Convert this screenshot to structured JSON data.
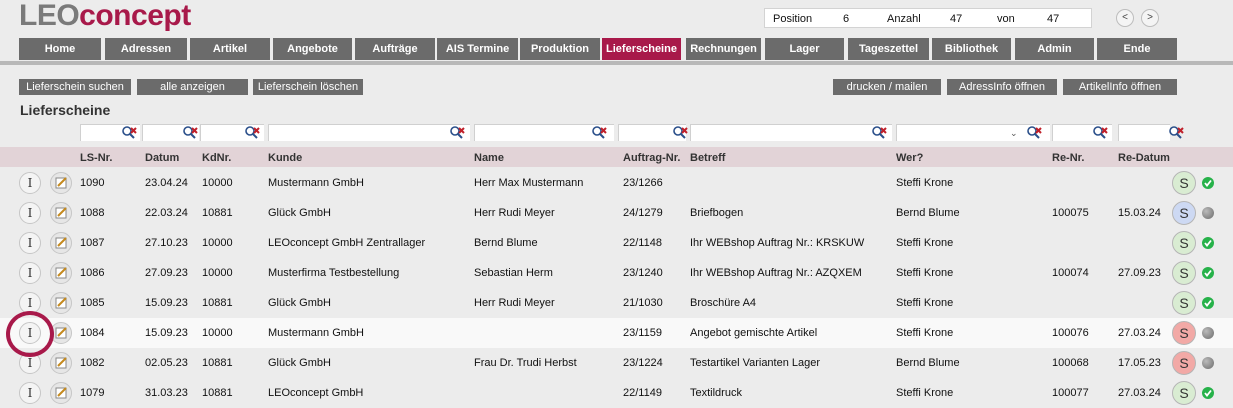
{
  "logo": {
    "part1": "LEO",
    "part2": "concept"
  },
  "position_box": {
    "position_label": "Position",
    "position_value": "6",
    "count_label": "Anzahl",
    "count_value": "47",
    "of_label": "von",
    "of_value": "47"
  },
  "nav_buttons": {
    "prev": "<",
    "next": ">"
  },
  "tabs": [
    "Home",
    "Adressen",
    "Artikel",
    "Angebote",
    "Aufträge",
    "AIS Termine",
    "Produktion",
    "Lieferscheine",
    "Rechnungen",
    "Lager",
    "Tageszettel",
    "Bibliothek",
    "Admin",
    "Ende"
  ],
  "active_tab": "Lieferscheine",
  "actions_left": [
    "Lieferschein suchen",
    "alle anzeigen",
    "Lieferschein löschen"
  ],
  "actions_right": [
    "drucken / mailen",
    "AdressInfo öffnen",
    "ArtikelInfo öffnen"
  ],
  "page_title": "Lieferscheine",
  "columns": [
    "LS-Nr.",
    "Datum",
    "KdNr.",
    "Kunde",
    "Name",
    "Auftrag-Nr.",
    "Betreff",
    "Wer?",
    "Re-Nr.",
    "Re-Datum"
  ],
  "info_icon_glyph": "I",
  "rows": [
    {
      "ls": "1090",
      "datum": "23.04.24",
      "kd": "10000",
      "kunde": "Mustermann GmbH",
      "name": "Herr Max Mustermann",
      "auftrag": "23/1266",
      "betreff": "",
      "wer": "Steffi Krone",
      "renr": "",
      "redatum": "",
      "status": "S",
      "status_color": "#d9ecd2",
      "dot": "green"
    },
    {
      "ls": "1088",
      "datum": "22.03.24",
      "kd": "10881",
      "kunde": "Glück GmbH",
      "name": "Herr Rudi Meyer",
      "auftrag": "24/1279",
      "betreff": "Briefbogen",
      "wer": "Bernd Blume",
      "renr": "100075",
      "redatum": "15.03.24",
      "status": "S",
      "status_color": "#cdd9f3",
      "dot": "grey"
    },
    {
      "ls": "1087",
      "datum": "27.10.23",
      "kd": "10000",
      "kunde": "LEOconcept GmbH Zentrallager",
      "name": "Bernd Blume",
      "auftrag": "22/1148",
      "betreff": "Ihr WEBshop Auftrag Nr.: KRSKUW",
      "wer": "Steffi Krone",
      "renr": "",
      "redatum": "",
      "status": "S",
      "status_color": "#d9ecd2",
      "dot": "green"
    },
    {
      "ls": "1086",
      "datum": "27.09.23",
      "kd": "10000",
      "kunde": "Musterfirma Testbestellung",
      "name": "Sebastian Herm",
      "auftrag": "23/1240",
      "betreff": "Ihr WEBshop Auftrag Nr.: AZQXEM",
      "wer": "Steffi Krone",
      "renr": "100074",
      "redatum": "27.09.23",
      "status": "S",
      "status_color": "#d9ecd2",
      "dot": "green"
    },
    {
      "ls": "1085",
      "datum": "15.09.23",
      "kd": "10881",
      "kunde": "Glück GmbH",
      "name": "Herr Rudi Meyer",
      "auftrag": "21/1030",
      "betreff": "Broschüre A4",
      "wer": "Steffi Krone",
      "renr": "",
      "redatum": "",
      "status": "S",
      "status_color": "#d9ecd2",
      "dot": "green"
    },
    {
      "ls": "1084",
      "datum": "15.09.23",
      "kd": "10000",
      "kunde": "Mustermann GmbH",
      "name": "",
      "auftrag": "23/1159",
      "betreff": "Angebot gemischte Artikel",
      "wer": "Steffi Krone",
      "renr": "100076",
      "redatum": "27.03.24",
      "status": "S",
      "status_color": "#f2a9a6",
      "dot": "grey"
    },
    {
      "ls": "1082",
      "datum": "02.05.23",
      "kd": "10881",
      "kunde": "Glück GmbH",
      "name": "Frau Dr. Trudi Herbst",
      "auftrag": "23/1224",
      "betreff": "Testartikel Varianten Lager",
      "wer": "Bernd Blume",
      "renr": "100068",
      "redatum": "17.05.23",
      "status": "S",
      "status_color": "#f2a9a6",
      "dot": "grey"
    },
    {
      "ls": "1079",
      "datum": "31.03.23",
      "kd": "10881",
      "kunde": "LEOconcept GmbH",
      "name": "",
      "auftrag": "22/1149",
      "betreff": "Textildruck",
      "wer": "Steffi Krone",
      "renr": "100077",
      "redatum": "27.03.24",
      "status": "S",
      "status_color": "#d9ecd2",
      "dot": "green"
    }
  ]
}
